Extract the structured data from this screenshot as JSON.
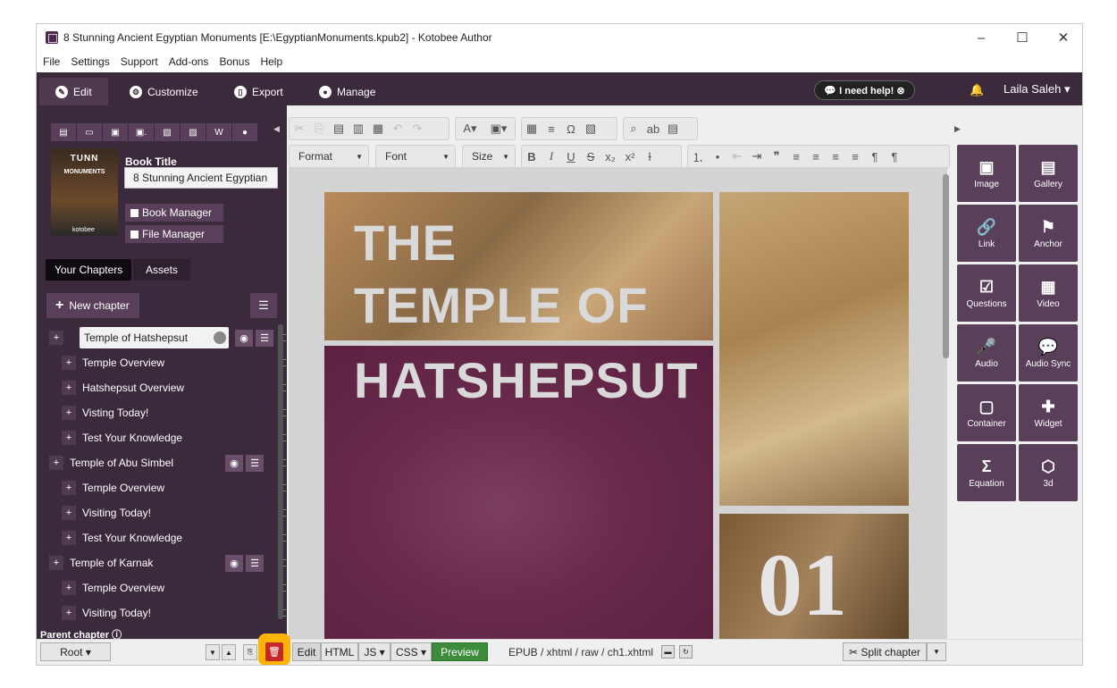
{
  "window": {
    "title": "8 Stunning Ancient Egyptian Monuments [E:\\EgyptianMonuments.kpub2] - Kotobee Author",
    "minimize": "–",
    "maximize": "☐",
    "close": "✕"
  },
  "menu": [
    "File",
    "Settings",
    "Support",
    "Add-ons",
    "Bonus",
    "Help"
  ],
  "tabs": [
    {
      "label": "Edit",
      "icon": "pencil-icon"
    },
    {
      "label": "Customize",
      "icon": "wrench-icon"
    },
    {
      "label": "Export",
      "icon": "export-icon"
    },
    {
      "label": "Manage",
      "icon": "user-icon"
    }
  ],
  "header": {
    "help_label": "💬 I need help! ⊗",
    "user_name": "Laila Saleh ▾",
    "bell": "🔔"
  },
  "left_panel": {
    "cover_text": "TUNN",
    "cover_sub": "MONUMENTS",
    "cover_brand": "kotobee",
    "book_title_label": "Book Title",
    "book_title_value": "8 Stunning Ancient Egyptian",
    "book_manager": "Book Manager",
    "file_manager": "File Manager",
    "tab_chapters": "Your Chapters",
    "tab_assets": "Assets",
    "new_chapter": "New chapter",
    "parent_chapter_label": "Parent chapter",
    "root_select": "Root ▾"
  },
  "chapters": [
    {
      "label": "Temple of Hatshepsut",
      "level": 0,
      "selected": true
    },
    {
      "label": "Temple Overview",
      "level": 1
    },
    {
      "label": "Hatshepsut Overview",
      "level": 1
    },
    {
      "label": "Visting Today!",
      "level": 1
    },
    {
      "label": "Test Your Knowledge",
      "level": 1
    },
    {
      "label": "Temple of Abu Simbel",
      "level": 0
    },
    {
      "label": "Temple Overview",
      "level": 1
    },
    {
      "label": "Visiting Today!",
      "level": 1
    },
    {
      "label": "Test Your Knowledge",
      "level": 1
    },
    {
      "label": "Temple of Karnak",
      "level": 0
    },
    {
      "label": "Temple Overview",
      "level": 1
    },
    {
      "label": "Visiting Today!",
      "level": 1
    }
  ],
  "toolbar": {
    "format": "Format",
    "font": "Font",
    "size": "Size"
  },
  "editor": {
    "title_line1": "THE",
    "title_line2": "TEMPLE OF",
    "title_line3": "HATSHEPSUT",
    "number": "01"
  },
  "bottom": {
    "edit": "Edit",
    "html": "HTML",
    "js": "JS ▾",
    "css": "CSS ▾",
    "preview": "Preview",
    "path": "EPUB / xhtml / raw / ch1.xhtml",
    "split_chapter": "✂ Split chapter"
  },
  "widgets": [
    {
      "label": "Image",
      "icon": "▣"
    },
    {
      "label": "Gallery",
      "icon": "▤"
    },
    {
      "label": "Link",
      "icon": "🔗"
    },
    {
      "label": "Anchor",
      "icon": "⚑"
    },
    {
      "label": "Questions",
      "icon": "☑"
    },
    {
      "label": "Video",
      "icon": "▦"
    },
    {
      "label": "Audio",
      "icon": "🎤"
    },
    {
      "label": "Audio Sync",
      "icon": "💬"
    },
    {
      "label": "Container",
      "icon": "▢"
    },
    {
      "label": "Widget",
      "icon": "✚"
    },
    {
      "label": "Equation",
      "icon": "Σ"
    },
    {
      "label": "3d",
      "icon": "⬡"
    }
  ],
  "colors": {
    "accent": "#5a3f5a",
    "dark_bg": "#3b2a3b",
    "highlight": "#ffb400",
    "delete": "#c62828",
    "preview": "#3c8c3c"
  }
}
